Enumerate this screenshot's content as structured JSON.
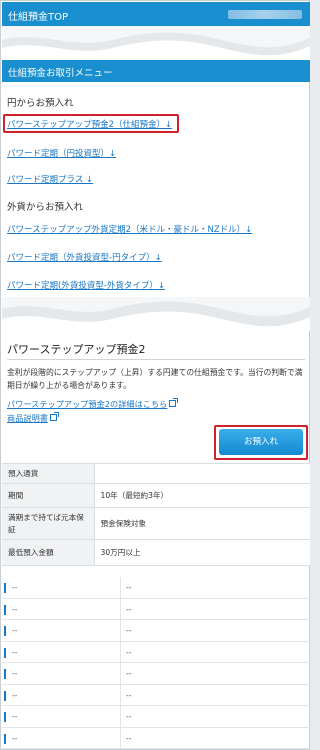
{
  "header": {
    "title": "仕組預金TOP"
  },
  "menu": {
    "title": "仕組預金お取引メニュー",
    "yen_group": "円からお預入れ",
    "yen_links": [
      "パワーステップアップ預金2（仕組預金）↓",
      "パワード定期（円投資型）↓",
      "パワード定期プラス ↓"
    ],
    "fx_group": "外貨からお預入れ",
    "fx_links": [
      "パワーステップアップ外貨定期2（米ドル・豪ドル・NZドル）↓",
      "パワード定期（外貨投資型-円タイプ）↓",
      "パワード定期(外貨投資型-外貨タイプ）↓"
    ]
  },
  "product": {
    "title": "パワーステップアップ預金2",
    "description": "金利が段階的にステップアップ（上昇）する円建ての仕組預金です。当行の判断で満期日が繰り上がる場合があります。",
    "detail_link": "パワーステップアップ預金2の詳細はこちら",
    "doc_link": "商品説明書",
    "deposit_button": "お預入れ"
  },
  "spec_rows": [
    {
      "label": "預入通貨",
      "value": ""
    },
    {
      "label": "期間",
      "value": "10年（最短約3年）"
    },
    {
      "label": "満期まで持てば元本保証",
      "value": "預金保険対象"
    },
    {
      "label": "最低預入金額",
      "value": "30万円以上"
    }
  ],
  "list_rows": [
    {
      "a": "--",
      "b": "--"
    },
    {
      "a": "--",
      "b": "--"
    },
    {
      "a": "--",
      "b": "--"
    },
    {
      "a": "--",
      "b": "--"
    },
    {
      "a": "--",
      "b": "--"
    },
    {
      "a": "--",
      "b": "--"
    },
    {
      "a": "--",
      "b": "--"
    },
    {
      "a": "--",
      "b": "--"
    }
  ],
  "colors": {
    "brand_blue": "#1a8fd0",
    "link_blue": "#1a77c4",
    "highlight_red": "#d0202c"
  }
}
